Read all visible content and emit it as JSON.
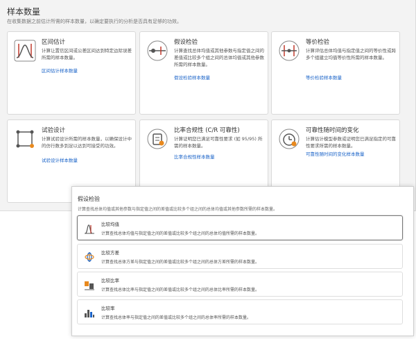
{
  "panel": {
    "title": "样本数量",
    "subtitle": "在收集数据之前估计所需的样本数量，以确定要执行的分析是否具有足够的功效。"
  },
  "cards": [
    {
      "title": "区间估计",
      "description": "计算让置信区间或公差区间达到特定边际误差所需的样本数量。",
      "link": "区间估计样本数量",
      "icon": "interval-estimate-icon"
    },
    {
      "title": "假设检验",
      "description": "计算查找总体均值或其他参数与指定值之间的差值或比较多个组之间的总体均值或其他参数所需的样本数量。",
      "link": "假设检验样本数量",
      "icon": "hypothesis-test-icon"
    },
    {
      "title": "等价检验",
      "description": "计算评估总体均值与指定值之间的等价性或跨多个组建立均值等价性所需的样本数量。",
      "link": "等价检验样本数量",
      "icon": "equivalence-test-icon"
    },
    {
      "title": "试验设计",
      "description": "计算试验设计所需的样本数量，以确保设计中的仿行数多到足以达到可接受的功效。",
      "link": "试验设计样本数量",
      "icon": "doe-icon"
    },
    {
      "title": "比率合规性 (C/R 可靠性)",
      "description": "计算证明您已满足可靠性要求 (如 95/95) 所需的样本数量。",
      "link": "比率合规性样本数量",
      "icon": "proportion-compliance-icon"
    },
    {
      "title": "可靠性随时间的变化",
      "description": "计算估计模型参数或证明您已满足指定的可靠性要求所需的样本数量。",
      "link": "可靠性随时间的变化样本数量",
      "icon": "reliability-time-icon"
    }
  ],
  "dialog": {
    "title": "假设检验",
    "subtitle": "计算查找总体均值或其他参数与指定值之间的差值或比较多个组之间的总体均值或其他参数所需的样本数量。",
    "options": [
      {
        "title": "比较均值",
        "description": "计算查找总体均值与指定值之间的差值或比较多个组之间的总体均值所需的样本数量。",
        "icon": "compare-means-icon",
        "selected": true
      },
      {
        "title": "比较方差",
        "description": "计算查找总体方差与指定值之间的差值或比较多个组之间的总体方差所需的样本数量。",
        "icon": "compare-variances-icon",
        "selected": false
      },
      {
        "title": "比较比率",
        "description": "计算查找总体比率与指定值之间的差值或比较多个组之间的总体比率所需的样本数量。",
        "icon": "compare-proportions-icon",
        "selected": false
      },
      {
        "title": "比较率",
        "description": "计算查找总体率与指定值之间的差值或比较多个组之间的总体率所需的样本数量。",
        "icon": "compare-rates-icon",
        "selected": false
      }
    ]
  },
  "colors": {
    "link": "#1a63c8",
    "accent_red": "#c0392b",
    "accent_orange": "#e8891e",
    "icon_gray": "#555555"
  }
}
